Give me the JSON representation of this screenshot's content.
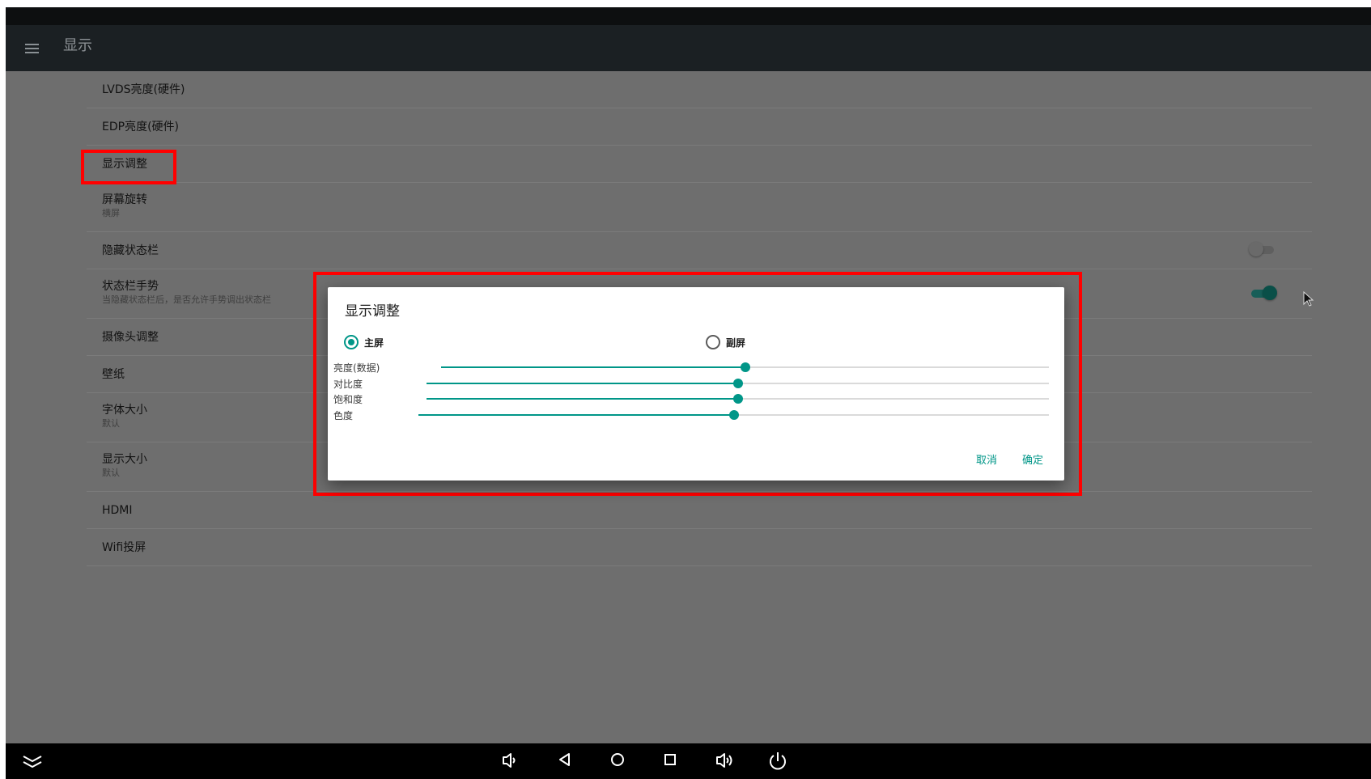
{
  "app": {
    "title": "显示"
  },
  "items": [
    {
      "title": "LVDS亮度(硬件)"
    },
    {
      "title": "EDP亮度(硬件)"
    },
    {
      "title": "显示调整"
    },
    {
      "title": "屏幕旋转",
      "summary": "横屏"
    },
    {
      "title": "隐藏状态栏",
      "toggle": false
    },
    {
      "title": "状态栏手势",
      "summary": "当隐藏状态栏后，是否允许手势调出状态栏",
      "toggle": true
    },
    {
      "title": "摄像头调整"
    },
    {
      "title": "壁纸"
    },
    {
      "title": "字体大小",
      "summary": "默认"
    },
    {
      "title": "显示大小",
      "summary": "默认"
    },
    {
      "title": "HDMI"
    },
    {
      "title": "Wifi投屏"
    }
  ],
  "dialog": {
    "title": "显示调整",
    "radios": [
      {
        "label": "主屏",
        "checked": true
      },
      {
        "label": "副屏",
        "checked": false
      }
    ],
    "sliders": [
      {
        "label": "亮度(数据)",
        "value": 0.5
      },
      {
        "label": "对比度",
        "value": 0.5
      },
      {
        "label": "饱和度",
        "value": 0.5
      },
      {
        "label": "色度",
        "value": 0.5
      }
    ],
    "cancel": "取消",
    "ok": "确定"
  },
  "nav_icons": [
    "keyboard-hide-icon",
    "volume-down-icon",
    "back-icon",
    "home-icon",
    "recents-icon",
    "volume-up-icon",
    "power-icon"
  ],
  "colors": {
    "accent": "#009688",
    "highlight": "#ff0000",
    "appbar": "#1b2023",
    "scrim_bg": "#6e6e6e"
  }
}
